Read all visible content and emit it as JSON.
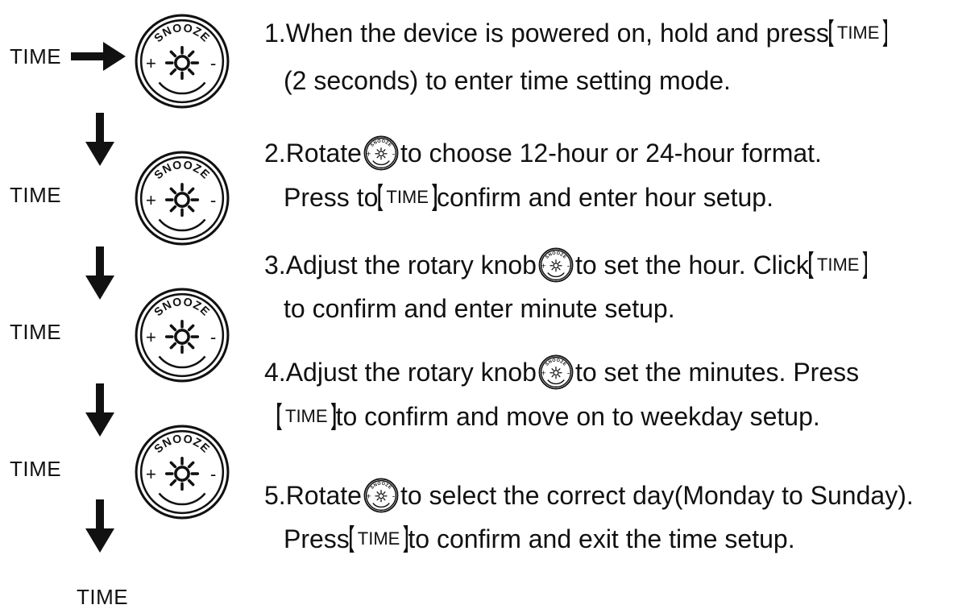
{
  "left_panel": {
    "time_labels": [
      "TIME",
      "TIME",
      "TIME",
      "TIME",
      "TIME"
    ],
    "knob_text": "SNOOZE",
    "knob_plus": "+",
    "knob_minus": "-"
  },
  "bracket_label": "TIME",
  "steps": [
    {
      "l1_a": "1.When the device is powered on, hold and press ",
      "l2_a": "(2 seconds) to enter time setting mode."
    },
    {
      "l1_a": "2.Rotate",
      "l1_b": " to choose 12-hour or 24-hour format.",
      "l2_a": "Press  to",
      "l2_b": "confirm and enter hour setup."
    },
    {
      "l1_a": "3.Adjust the rotary knob",
      "l1_b": " to set the hour. Click ",
      "l2_a": "to confirm and enter minute setup."
    },
    {
      "l1_a": "4.Adjust the rotary knob",
      "l1_b": " to set the minutes. Press",
      "l2_b": " to confirm and move on to weekday setup."
    },
    {
      "l1_a": "5.Rotate",
      "l1_b": " to select the correct day(Monday to Sunday).",
      "l2_a": "Press ",
      "l2_b": " to confirm and exit the time setup."
    }
  ]
}
